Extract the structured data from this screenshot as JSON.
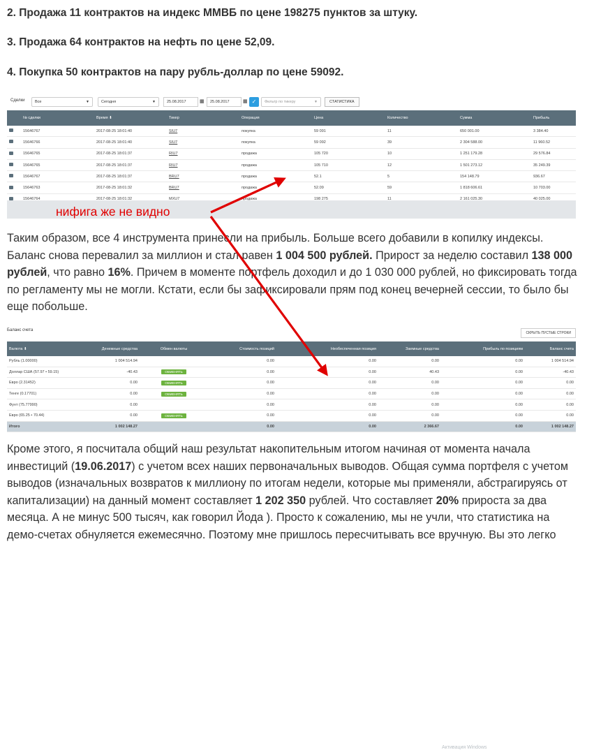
{
  "headings": [
    "2. Продажа 11 контрактов на индекс ММВБ по цене 198275 пунктов за штуку.",
    "3. Продажа 64 контрактов на нефть по цене 52,09.",
    "4. Покупка 50 контрактов на пару рубль-доллар по цене 59092."
  ],
  "deals_screen": {
    "toolbar": {
      "deals_label": "Сделки",
      "deals_filter": "Все",
      "period_select": "Сегодня",
      "date_from": "25.08.2017",
      "date_to": "25.08.2017",
      "ticker_placeholder": "Фильтр по тикеру",
      "stats_button": "СТАТИСТИКА"
    },
    "columns": [
      "№ сделки",
      "Время ⬇",
      "Тикер",
      "Операция",
      "Цена",
      "Количество",
      "Сумма",
      "Прибыль"
    ],
    "rows": [
      {
        "id": "15646767",
        "time": "2017-08-25 18:01:40",
        "ticker": "SIU7",
        "op": "покупка",
        "price": "59 091",
        "qty": "11",
        "sum": "650 001.00",
        "profit": "3 384.40"
      },
      {
        "id": "15646766",
        "time": "2017-08-25 18:01:40",
        "ticker": "SIU7",
        "op": "покупка",
        "price": "59 092",
        "qty": "39",
        "sum": "2 304 588.00",
        "profit": "11 960.52"
      },
      {
        "id": "15646765",
        "time": "2017-08-25 18:01:37",
        "ticker": "RIU7",
        "op": "продажа",
        "price": "105 720",
        "qty": "10",
        "sum": "1 251 179.28",
        "profit": "29 576.84"
      },
      {
        "id": "15646765",
        "time": "2017-08-25 18:01:37",
        "ticker": "RIU7",
        "op": "продажа",
        "price": "105 710",
        "qty": "12",
        "sum": "1 501 273.12",
        "profit": "35 249.39"
      },
      {
        "id": "15646767",
        "time": "2017-08-25 18:01:37",
        "ticker": "BRU7",
        "op": "продажа",
        "price": "52.1",
        "qty": "5",
        "sum": "154 148.79",
        "profit": "936.67"
      },
      {
        "id": "15646763",
        "time": "2017-08-25 18:01:32",
        "ticker": "BRU7",
        "op": "продажа",
        "price": "52.09",
        "qty": "59",
        "sum": "1 818 606.61",
        "profit": "10 703.00"
      },
      {
        "id": "15646764",
        "time": "2017-08-25 18:01:32",
        "ticker": "MXU7",
        "op": "продажа",
        "price": "198 275",
        "qty": "11",
        "sum": "2 161 025.30",
        "profit": "40 025.00"
      }
    ]
  },
  "annotation": "нифига же не видно",
  "paragraph1": {
    "t1": "Таким образом, все 4 инструмента принесли на прибыль. Больше всего добавили в копилку индексы. Баланс снова перевалил за миллион и стал равен ",
    "b1": "1 004 500 рублей.",
    "t2": " Прирост за неделю составил ",
    "b2": "138 000 рублей",
    "t3": ", что равно ",
    "b3": "16%",
    "t4": ". Причем в моменте портфель доходил и до 1 030 000 рублей, но фиксировать тогда по регламенту мы не могли. Кстати, если бы зафиксировали прям под конец вечерней сессии, то было бы еще побольше."
  },
  "balance_screen": {
    "title": "Баланс счета",
    "hide_button": "СКРЫТЬ ПУСТЫЕ СТРОКИ",
    "columns": [
      "Валюта ⬇",
      "Денежные средства",
      "Обмен валюты",
      "Стоимость позиций",
      "Необеспеченная позиция",
      "Заемные средства",
      "Прибыль по позициям",
      "Баланс счета"
    ],
    "rows": [
      {
        "cur": "Рубль (1.00000)",
        "cash": "1 004 514.94",
        "cash_neg": false,
        "exch": "",
        "pos": "0.00",
        "unsec": "0.00",
        "loan": "0.00",
        "profit": "0.00",
        "bal": "1 004 514.94"
      },
      {
        "cur": "Доллар США (57.97 • 59.15)",
        "cash": "-40.43",
        "cash_neg": true,
        "exch": "ОБМЕНЯТЬ",
        "pos": "0.00",
        "unsec": "0.00",
        "loan": "40.43",
        "profit": "0.00",
        "bal": "-40.43"
      },
      {
        "cur": "Евро (2.31452)",
        "cash": "0.00",
        "cash_neg": true,
        "exch": "ОБМЕНЯТЬ",
        "pos": "0.00",
        "unsec": "0.00",
        "loan": "0.00",
        "profit": "0.00",
        "bal": "0.00"
      },
      {
        "cur": "Тенге (0.17701)",
        "cash": "0.00",
        "cash_neg": true,
        "exch": "ОБМЕНЯТЬ",
        "pos": "0.00",
        "unsec": "0.00",
        "loan": "0.00",
        "profit": "0.00",
        "bal": "0.00"
      },
      {
        "cur": "Фунт (75.77990)",
        "cash": "0.00",
        "cash_neg": false,
        "exch": "",
        "pos": "0.00",
        "unsec": "0.00",
        "loan": "0.00",
        "profit": "0.00",
        "bal": "0.00"
      },
      {
        "cur": "Евро (65.25 • 70.44)",
        "cash": "0.00",
        "cash_neg": false,
        "exch": "ОБМЕНЯТЬ",
        "pos": "0.00",
        "unsec": "0.00",
        "loan": "0.00",
        "profit": "0.00",
        "bal": "0.00"
      }
    ],
    "total": {
      "cur": "Итого",
      "cash": "1 002 148.27",
      "pos": "0.00",
      "unsec": "0.00",
      "loan": "2 366.67",
      "profit": "0.00",
      "bal": "1 002 148.27"
    },
    "watermark": "Активация Windows"
  },
  "paragraph2": {
    "t1": "Кроме этого, я посчитала общий наш результат накопительным итогом начиная от момента начала инвестиций (",
    "b1": "19.06.2017",
    "t2": ") с учетом всех наших первоначальных выводов. Общая сумма портфеля с учетом выводов (изначальных возвратов к миллиону по итогам недели, которые мы применяли, абстрагируясь от капитализации) на данный момент составляет ",
    "b2": "1 202 350",
    "t3": " рублей. Что составляет ",
    "b3": "20%",
    "t4": " прироста за два месяца. А не минус 500 тысяч, как говорил Йода ). Просто к сожалению, мы не учли, что статистика на демо-счетах обнуляется ежемесячно. Поэтому мне пришлось пересчитывать все вручную. Вы это легко"
  },
  "colors": {
    "header": "#5b6f7b",
    "profit": "#5a9d3b",
    "loss": "#c0392b",
    "annotation": "#e00000",
    "button": "#6db33f",
    "accent": "#2d9ee0"
  }
}
